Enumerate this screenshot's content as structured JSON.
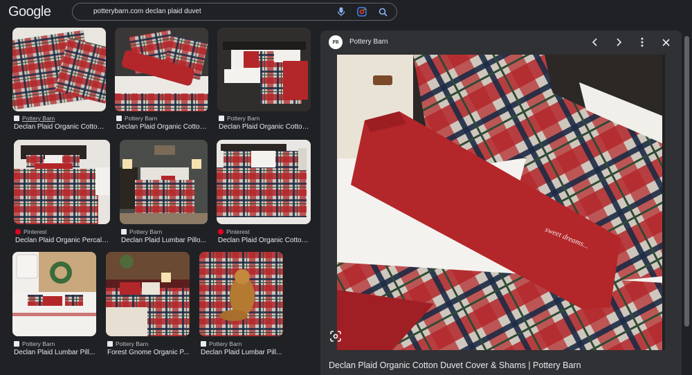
{
  "header": {
    "logo": "Google",
    "search_query": "potterybarn.com declan plaid duvet",
    "icons": [
      "mic-icon",
      "lens-icon",
      "search-icon"
    ]
  },
  "results": [
    {
      "source": "Pottery Barn",
      "favicon": "pb",
      "title": "Declan Plaid Organic Cotton..."
    },
    {
      "source": "Pottery Barn",
      "favicon": "pb",
      "title": "Declan Plaid Organic Cotton..."
    },
    {
      "source": "Pottery Barn",
      "favicon": "pb",
      "title": "Declan Plaid Organic Cotton..."
    },
    {
      "source": "Pinterest",
      "favicon": "pin",
      "title": "Declan Plaid Organic Percale..."
    },
    {
      "source": "Pottery Barn",
      "favicon": "pb",
      "title": "Declan Plaid Lumbar Pillo..."
    },
    {
      "source": "Pinterest",
      "favicon": "pin",
      "title": "Declan Plaid Organic Cotton ..."
    },
    {
      "source": "Pottery Barn",
      "favicon": "pb",
      "title": "Declan Plaid Lumbar Pill..."
    },
    {
      "source": "Pottery Barn",
      "favicon": "pb",
      "title": "Forest Gnome Organic P..."
    },
    {
      "source": "Pottery Barn",
      "favicon": "pb",
      "title": "Declan Plaid Lumbar Pill..."
    }
  ],
  "panel": {
    "site_logo": "PB",
    "site_name": "Pottery Barn",
    "pillow_text": "sweet dreams...",
    "title": "Declan Plaid Organic Cotton Duvet Cover & Shams | Pottery Barn"
  },
  "colors": {
    "background": "#202124",
    "panel": "#303134",
    "text": "#e8eaed",
    "plaid_red": "#b3262a",
    "plaid_navy": "#1d2a44",
    "plaid_green": "#2f4a34"
  }
}
